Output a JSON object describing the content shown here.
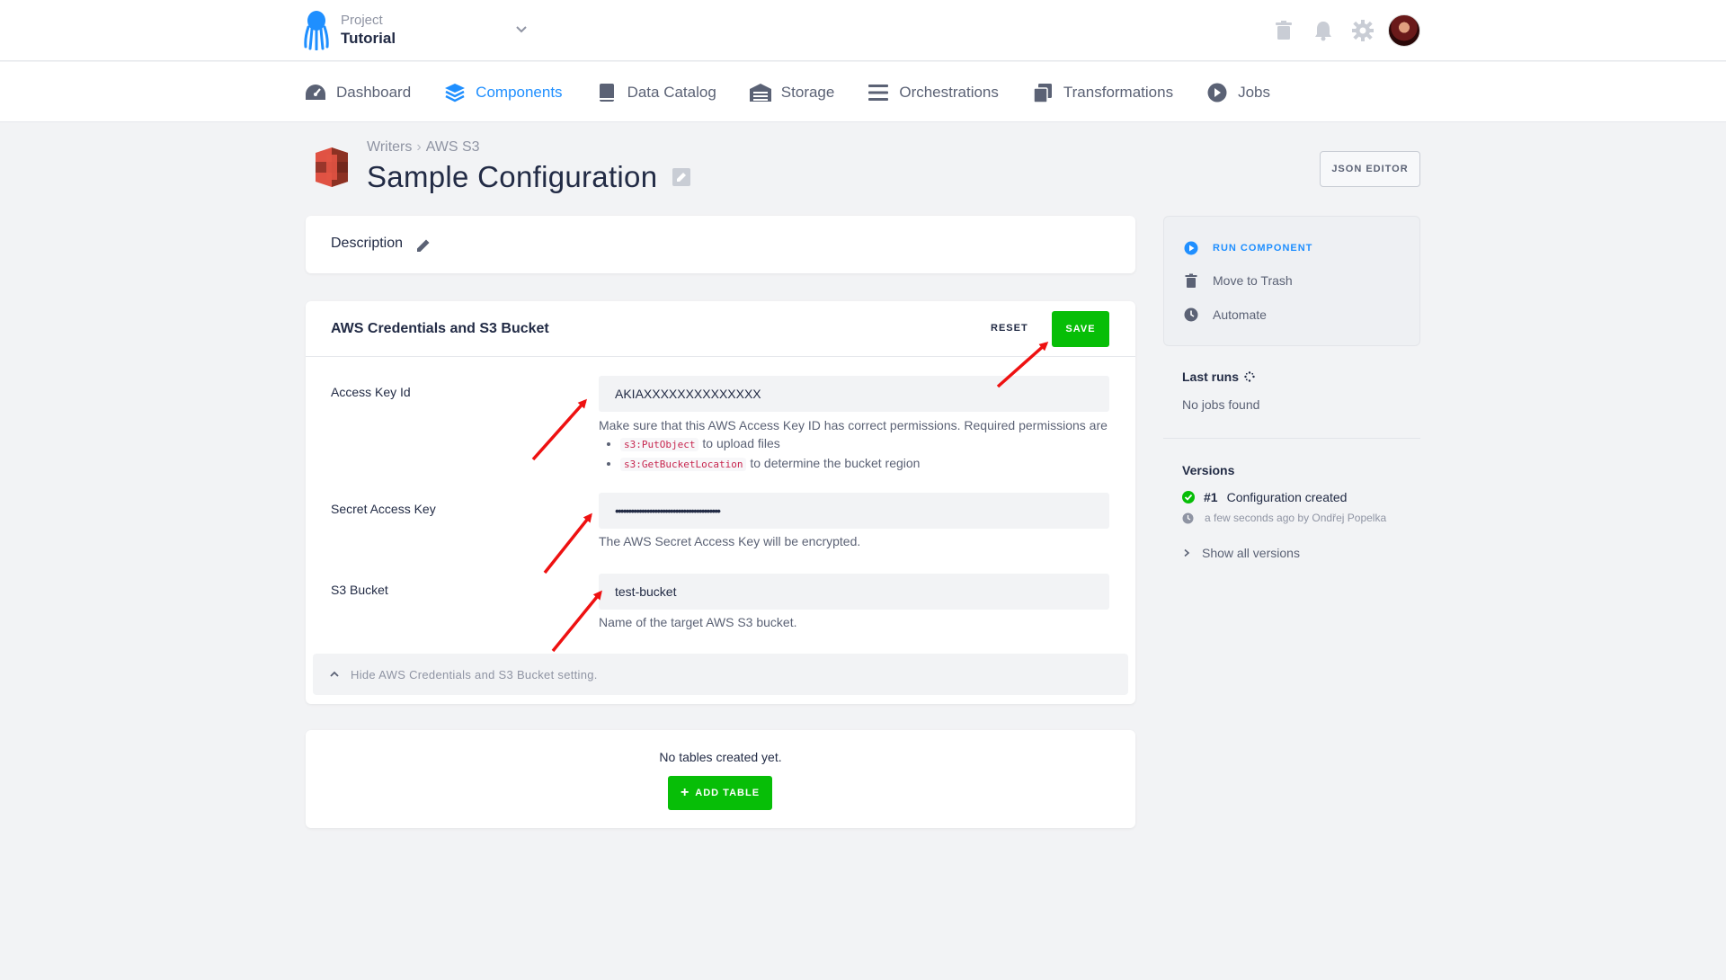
{
  "header": {
    "project_label": "Project",
    "project_name": "Tutorial",
    "icons": [
      "trash-icon",
      "bell-icon",
      "gear-icon"
    ]
  },
  "nav": {
    "items": [
      {
        "label": "Dashboard",
        "icon": "dashboard-icon"
      },
      {
        "label": "Components",
        "icon": "layers-icon",
        "active": true
      },
      {
        "label": "Data Catalog",
        "icon": "book-icon"
      },
      {
        "label": "Storage",
        "icon": "warehouse-icon"
      },
      {
        "label": "Orchestrations",
        "icon": "list-icon"
      },
      {
        "label": "Transformations",
        "icon": "copy-icon"
      },
      {
        "label": "Jobs",
        "icon": "play-icon"
      }
    ]
  },
  "page": {
    "breadcrumb": [
      "Writers",
      "AWS S3"
    ],
    "breadcrumb_sep": "›",
    "title": "Sample Configuration",
    "json_editor": "JSON EDITOR"
  },
  "description": {
    "label": "Description"
  },
  "credentials": {
    "title": "AWS Credentials and S3 Bucket",
    "reset": "RESET",
    "save": "SAVE",
    "fields": [
      {
        "label": "Access Key Id",
        "value": "AKIAXXXXXXXXXXXXXX",
        "help": "Make sure that this AWS Access Key ID has correct permissions. Required permissions are",
        "permissions": [
          {
            "code": "s3:PutObject",
            "text": "to upload files"
          },
          {
            "code": "s3:GetBucketLocation",
            "text": "to determine the bucket region"
          }
        ]
      },
      {
        "label": "Secret Access Key",
        "value": "••••••••••••••••••••••••••••••••••••••••",
        "help": "The AWS Secret Access Key will be encrypted."
      },
      {
        "label": "S3 Bucket",
        "value": "test-bucket",
        "help": "Name of the target AWS S3 bucket."
      }
    ],
    "hide_text": "Hide AWS Credentials and S3 Bucket setting."
  },
  "tables": {
    "empty_text": "No tables created yet.",
    "add_button": "ADD TABLE",
    "add_icon": "+"
  },
  "sidebar": {
    "actions": [
      {
        "label": "RUN COMPONENT",
        "icon": "play-circle-icon"
      },
      {
        "label": "Move to Trash",
        "icon": "trash-icon"
      },
      {
        "label": "Automate",
        "icon": "clock-icon"
      }
    ],
    "last_runs_title": "Last runs",
    "last_runs_empty": "No jobs found",
    "versions_title": "Versions",
    "version": {
      "number": "#1",
      "description": "Configuration created",
      "meta": "a few seconds ago by Ondřej Popelka"
    },
    "show_all": "Show all versions"
  },
  "colors": {
    "accent": "#1f8fff",
    "success": "#07be07",
    "annotation_arrow": "#ee1111"
  }
}
